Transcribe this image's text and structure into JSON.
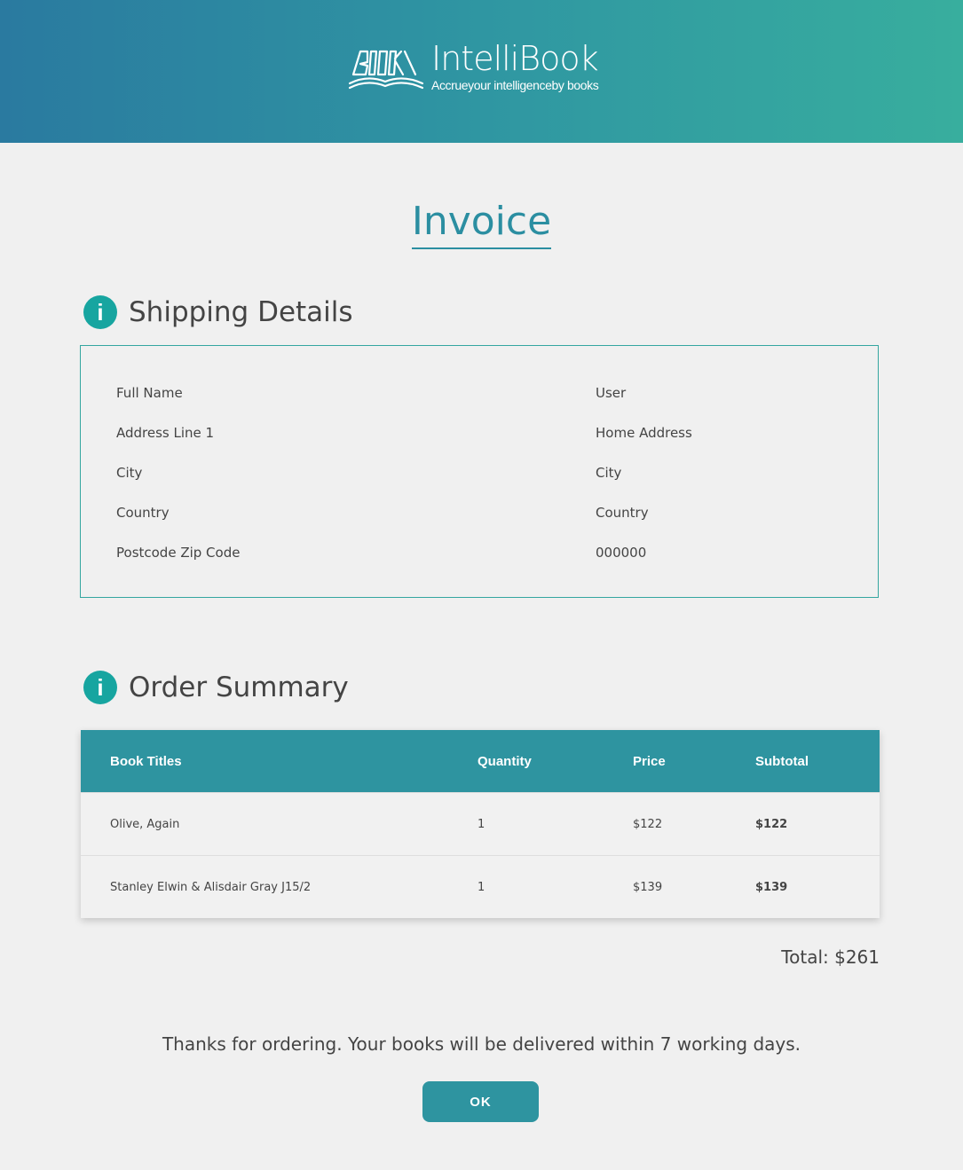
{
  "header": {
    "logo_mark_text": "BOOK",
    "brand_name": "IntelliBook",
    "tagline": "Accrueyour intelligenceby books"
  },
  "page_title": "Invoice",
  "shipping": {
    "section_title": "Shipping Details",
    "rows": [
      {
        "label": "Full Name",
        "value": "User"
      },
      {
        "label": "Address Line 1",
        "value": "Home Address"
      },
      {
        "label": "City",
        "value": "City"
      },
      {
        "label": "Country",
        "value": "Country"
      },
      {
        "label": "Postcode Zip Code",
        "value": "000000"
      }
    ]
  },
  "order": {
    "section_title": "Order Summary",
    "columns": [
      "Book Titles",
      "Quantity",
      "Price",
      "Subtotal"
    ],
    "items": [
      {
        "title": "Olive, Again",
        "quantity": "1",
        "price": "$122",
        "subtotal": "$122"
      },
      {
        "title": "Stanley Elwin & Alisdair Gray J15/2",
        "quantity": "1",
        "price": "$139",
        "subtotal": "$139"
      }
    ],
    "total_label": "Total: $261"
  },
  "footer": {
    "thanks_message": "Thanks for ordering. Your books will be delivered within 7 working days.",
    "ok_label": "OK"
  },
  "colors": {
    "accent": "#2e94a0",
    "info_icon": "#17a5a0",
    "background": "#f0f0f0"
  },
  "icons": {
    "section_icon": "info-icon",
    "logo_icon": "open-book-logo-icon"
  }
}
